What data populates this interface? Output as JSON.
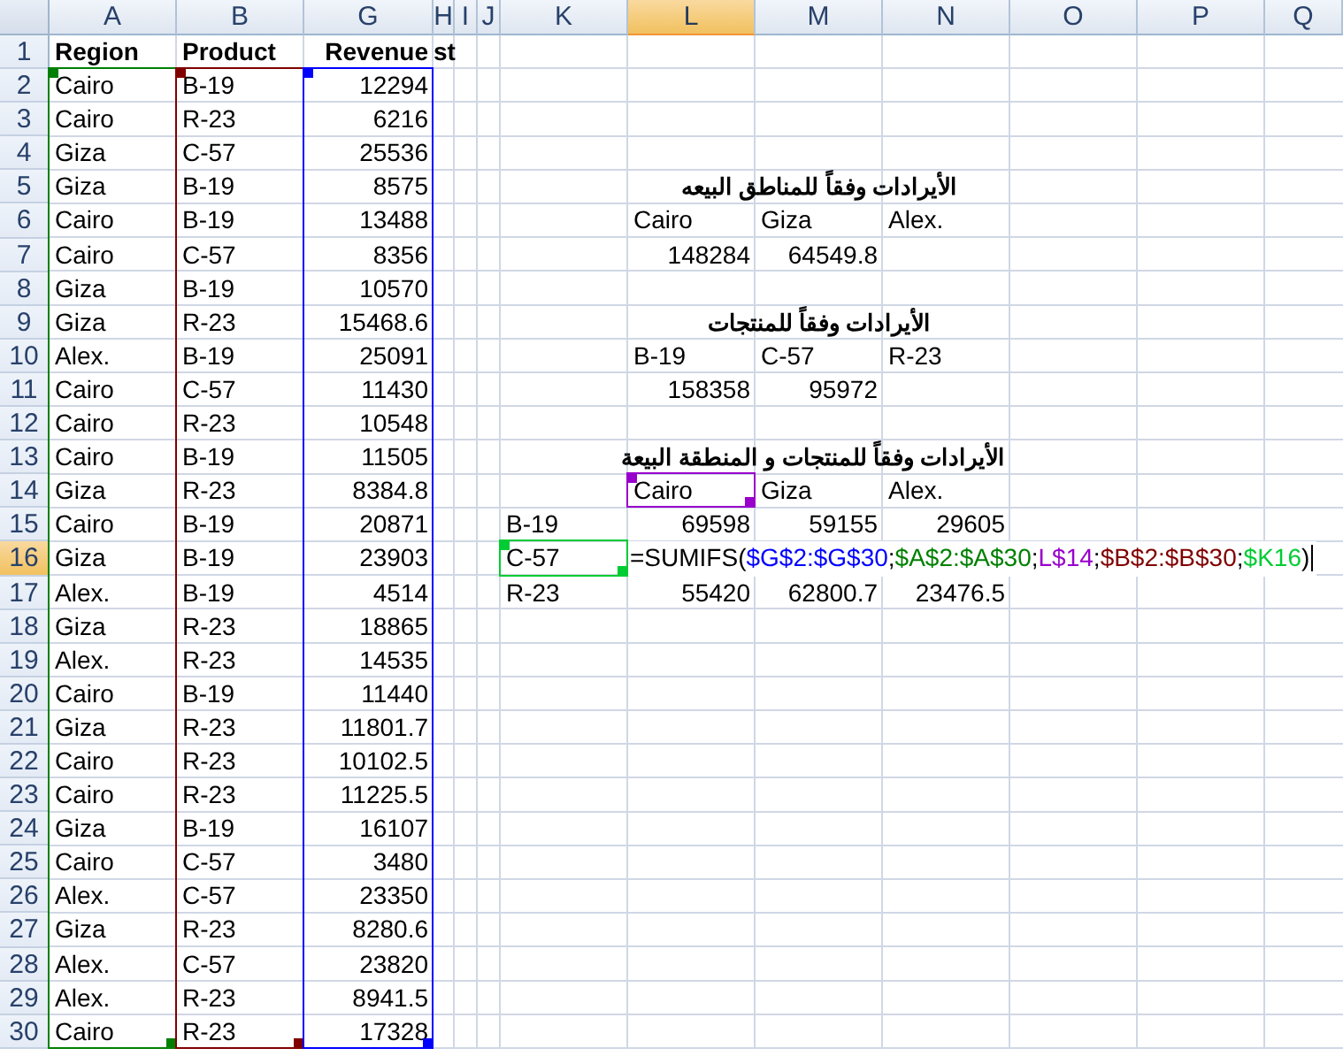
{
  "column_headers": [
    {
      "label": "A",
      "selected": false
    },
    {
      "label": "B",
      "selected": false
    },
    {
      "label": "G",
      "selected": false
    },
    {
      "label": "H",
      "selected": false
    },
    {
      "label": "I",
      "selected": false
    },
    {
      "label": "J",
      "selected": false
    },
    {
      "label": "K",
      "selected": false
    },
    {
      "label": "L",
      "selected": true
    },
    {
      "label": "M",
      "selected": false
    },
    {
      "label": "N",
      "selected": false
    },
    {
      "label": "O",
      "selected": false
    },
    {
      "label": "P",
      "selected": false
    },
    {
      "label": "Q",
      "selected": false
    }
  ],
  "row_headers": [
    {
      "label": "1",
      "selected": false
    },
    {
      "label": "2",
      "selected": false
    },
    {
      "label": "3",
      "selected": false
    },
    {
      "label": "4",
      "selected": false
    },
    {
      "label": "5",
      "selected": false
    },
    {
      "label": "6",
      "selected": false
    },
    {
      "label": "7",
      "selected": false
    },
    {
      "label": "8",
      "selected": false
    },
    {
      "label": "9",
      "selected": false
    },
    {
      "label": "10",
      "selected": false
    },
    {
      "label": "11",
      "selected": false
    },
    {
      "label": "12",
      "selected": false
    },
    {
      "label": "13",
      "selected": false
    },
    {
      "label": "14",
      "selected": false
    },
    {
      "label": "15",
      "selected": false
    },
    {
      "label": "16",
      "selected": true
    },
    {
      "label": "17",
      "selected": false
    },
    {
      "label": "18",
      "selected": false
    },
    {
      "label": "19",
      "selected": false
    },
    {
      "label": "20",
      "selected": false
    },
    {
      "label": "21",
      "selected": false
    },
    {
      "label": "22",
      "selected": false
    },
    {
      "label": "23",
      "selected": false
    },
    {
      "label": "24",
      "selected": false
    },
    {
      "label": "25",
      "selected": false
    },
    {
      "label": "26",
      "selected": false
    },
    {
      "label": "27",
      "selected": false
    },
    {
      "label": "28",
      "selected": false
    },
    {
      "label": "29",
      "selected": false
    },
    {
      "label": "30",
      "selected": false
    }
  ],
  "data_table": {
    "columns": [
      {
        "header": "Region",
        "kind": "text",
        "color": "#008000"
      },
      {
        "header": "Product",
        "kind": "text",
        "color": "#800000"
      },
      {
        "header": "Revenue",
        "kind": "number",
        "color": "#0000ff"
      }
    ],
    "overflow_text": "st",
    "rows": [
      [
        "Cairo",
        "B-19",
        "12294"
      ],
      [
        "Cairo",
        "R-23",
        "6216"
      ],
      [
        "Giza",
        "C-57",
        "25536"
      ],
      [
        "Giza",
        "B-19",
        "8575"
      ],
      [
        "Cairo",
        "B-19",
        "13488"
      ],
      [
        "Cairo",
        "C-57",
        "8356"
      ],
      [
        "Giza",
        "B-19",
        "10570"
      ],
      [
        "Giza",
        "R-23",
        "15468.6"
      ],
      [
        "Alex.",
        "B-19",
        "25091"
      ],
      [
        "Cairo",
        "C-57",
        "11430"
      ],
      [
        "Cairo",
        "R-23",
        "10548"
      ],
      [
        "Cairo",
        "B-19",
        "11505"
      ],
      [
        "Giza",
        "R-23",
        "8384.8"
      ],
      [
        "Cairo",
        "B-19",
        "20871"
      ],
      [
        "Giza",
        "B-19",
        "23903"
      ],
      [
        "Alex.",
        "B-19",
        "4514"
      ],
      [
        "Giza",
        "R-23",
        "18865"
      ],
      [
        "Alex.",
        "R-23",
        "14535"
      ],
      [
        "Cairo",
        "B-19",
        "11440"
      ],
      [
        "Giza",
        "R-23",
        "11801.7"
      ],
      [
        "Cairo",
        "R-23",
        "10102.5"
      ],
      [
        "Cairo",
        "R-23",
        "11225.5"
      ],
      [
        "Giza",
        "B-19",
        "16107"
      ],
      [
        "Cairo",
        "C-57",
        "3480"
      ],
      [
        "Alex.",
        "C-57",
        "23350"
      ],
      [
        "Giza",
        "R-23",
        "8280.6"
      ],
      [
        "Alex.",
        "C-57",
        "23820"
      ],
      [
        "Alex.",
        "R-23",
        "8941.5"
      ],
      [
        "Cairo",
        "R-23",
        "17328"
      ]
    ]
  },
  "summaries": [
    {
      "title": "الأيرادات وفقاً للمناطق البيعه",
      "labels": [
        "Cairo",
        "Giza",
        "Alex."
      ],
      "values": [
        "148284",
        "64549.8"
      ]
    },
    {
      "title": "الأيرادات وفقاً للمنتجات",
      "labels": [
        "B-19",
        "C-57",
        "R-23"
      ],
      "values": [
        "158358",
        "95972"
      ]
    }
  ],
  "matrix": {
    "title": "الأيرادات وفقاً للمنتجات و المنطقة البيعة",
    "columns": [
      {
        "text": "Cairo",
        "color": "#9900cc"
      },
      {
        "text": "Giza"
      },
      {
        "text": "Alex."
      }
    ],
    "rows": [
      {
        "label": "B-19",
        "values": [
          "69598",
          "59155",
          "29605"
        ]
      },
      {
        "label": "C-57",
        "color": "#00cc33",
        "editing": true,
        "formula": [
          {
            "text": "=SUMIFS("
          },
          {
            "text": "$G$2:$G$30",
            "color": "#0000ff"
          },
          {
            "text": ";"
          },
          {
            "text": "$A$2:$A$30",
            "color": "#008000"
          },
          {
            "text": ";"
          },
          {
            "text": "L$14",
            "color": "#9900cc"
          },
          {
            "text": ";"
          },
          {
            "text": "$B$2:$B$30",
            "color": "#800000"
          },
          {
            "text": ";"
          },
          {
            "text": "$K16",
            "color": "#00cc33"
          },
          {
            "text": ")"
          }
        ]
      },
      {
        "label": "R-23",
        "values": [
          "55420",
          "62800.7",
          "23476.5"
        ]
      }
    ]
  }
}
